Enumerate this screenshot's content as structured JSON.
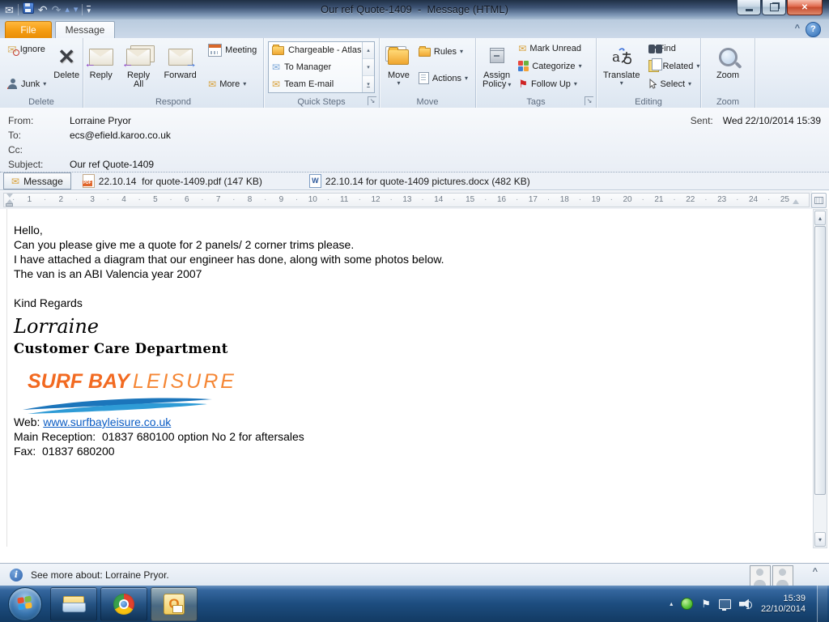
{
  "window": {
    "title": "Our ref Quote-1409  -  Message (HTML)"
  },
  "tabs": {
    "file": "File",
    "message": "Message"
  },
  "ribbon": {
    "delete_group": {
      "caption": "Delete",
      "ignore": "Ignore",
      "junk": "Junk",
      "delete": "Delete"
    },
    "respond_group": {
      "caption": "Respond",
      "reply": "Reply",
      "reply_all": "Reply All",
      "forward": "Forward",
      "meeting": "Meeting",
      "more": "More"
    },
    "quick_steps_group": {
      "caption": "Quick Steps",
      "items": [
        "Chargeable - Atlas",
        "To Manager",
        "Team E-mail"
      ]
    },
    "move_group": {
      "caption": "Move",
      "move": "Move",
      "rules": "Rules",
      "actions": "Actions"
    },
    "tags_group": {
      "caption": "Tags",
      "assign_policy_line1": "Assign",
      "assign_policy_line2": "Policy",
      "mark_unread": "Mark Unread",
      "categorize": "Categorize",
      "follow_up": "Follow Up"
    },
    "editing_group": {
      "caption": "Editing",
      "translate": "Translate",
      "find": "Find",
      "related": "Related",
      "select": "Select"
    },
    "zoom_group": {
      "caption": "Zoom",
      "zoom": "Zoom"
    }
  },
  "header": {
    "from_label": "From:",
    "from_value": "Lorraine Pryor",
    "to_label": "To:",
    "to_value": "ecs@efield.karoo.co.uk",
    "cc_label": "Cc:",
    "cc_value": "",
    "subject_label": "Subject:",
    "subject_value": "Our ref Quote-1409",
    "sent_label": "Sent:",
    "sent_value": "Wed 22/10/2014 15:39"
  },
  "attachments": {
    "message_tab": "Message",
    "pdf_name": "22.10.14  for quote-1409.pdf (147 KB)",
    "docx_name": "22.10.14 for quote-1409 pictures.docx (482 KB)",
    "docx_icon_letter": "W"
  },
  "ruler": {
    "numbers": [
      1,
      2,
      3,
      4,
      5,
      6,
      7,
      8,
      9,
      10,
      11,
      12,
      13,
      14,
      15,
      16,
      17,
      18,
      19,
      20,
      21,
      22,
      23,
      24,
      25
    ]
  },
  "body": {
    "line1": "Hello,",
    "line2": "Can you please give me a quote for 2 panels/ 2 corner trims please.",
    "line3": "I have attached a diagram that our engineer has done, along with some photos below.",
    "line4": "The van is an ABI Valencia year 2007",
    "regards": "Kind Regards",
    "signature_name": "Lorraine",
    "signature_dept": "Customer Care Department",
    "logo_text_bold": "SURF BAY",
    "logo_text_light": "LEISURE",
    "web_label": "Web: ",
    "web_link": "www.surfbayleisure.co.uk",
    "reception_line": "Main Reception:  01837 680100 option No 2 for aftersales",
    "fax_line": "Fax:  01837 680200"
  },
  "people_pane": {
    "text": "See more about: Lorraine Pryor."
  },
  "taskbar": {
    "time": "15:39",
    "date": "22/10/2014"
  },
  "icons": {
    "envelope": "✉",
    "close": "✕",
    "delete_x": "✕",
    "flag": "⚑",
    "undo": "↶",
    "redo": "↷",
    "prev_arrow": "▴",
    "next_arrow": "▾",
    "dropdown_arrow": "▾",
    "reply_arrow": "←",
    "forward_arrow": "→",
    "help": "?",
    "collapse_ribbon": "^",
    "launcher_arrow": "↘",
    "info": "i",
    "tray_show_hidden": "▴",
    "people_collapse": "^",
    "qat_dropdown": "▾"
  },
  "colors": {
    "file_tab_orange": "#f59d13",
    "link_blue": "#0b5cc4",
    "logo_orange": "#f26a21",
    "wave_blue": "#1b75bb"
  }
}
